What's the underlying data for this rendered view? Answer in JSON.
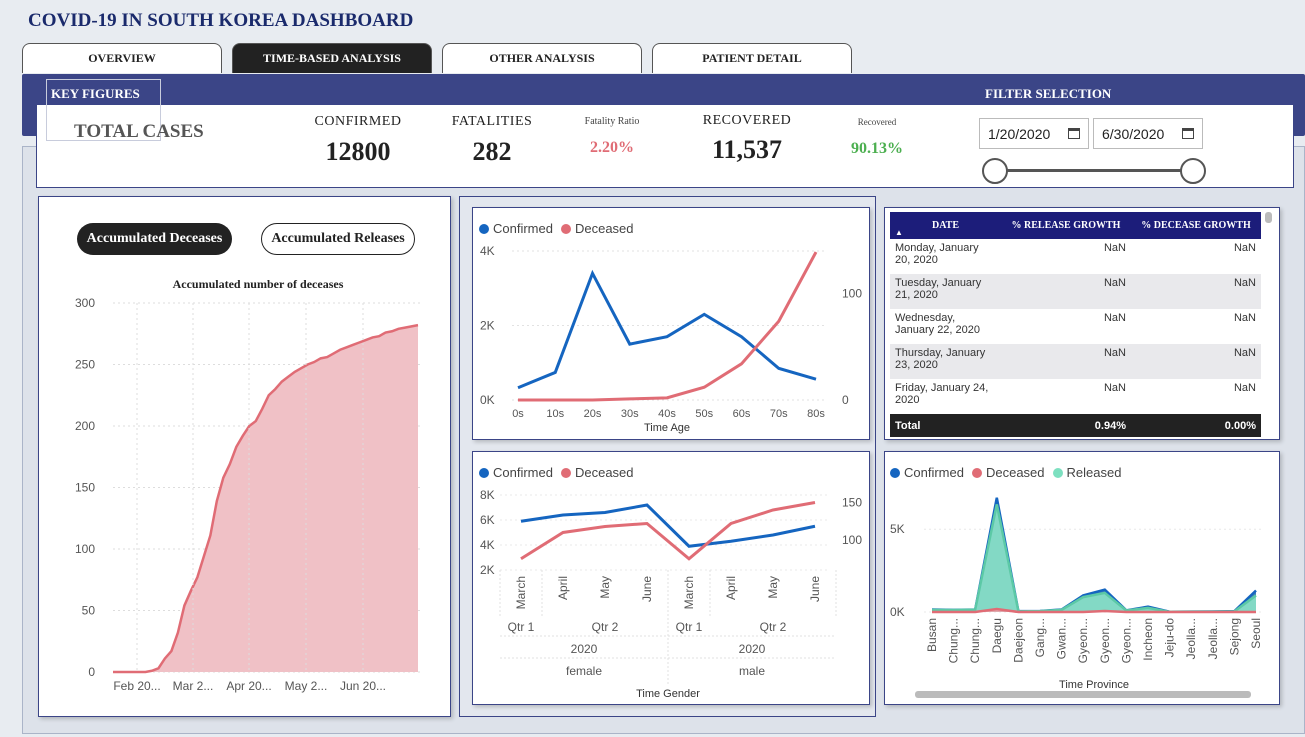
{
  "app": {
    "title": "COVID-19 IN SOUTH KOREA DASHBOARD"
  },
  "tabs": [
    {
      "label": "OVERVIEW",
      "active": false
    },
    {
      "label": "TIME-BASED ANALYSIS",
      "active": true
    },
    {
      "label": "OTHER ANALYSIS",
      "active": false
    },
    {
      "label": "PATIENT DETAIL",
      "active": false
    }
  ],
  "header": {
    "key_figures": "KEY FIGURES",
    "filter_selection": "FILTER SELECTION"
  },
  "kpis": {
    "total_cases_label": "TOTAL CASES",
    "confirmed_label": "CONFIRMED",
    "confirmed_value": "12800",
    "fatalities_label": "FATALITIES",
    "fatalities_value": "282",
    "fatality_ratio_label": "Fatality Ratio",
    "fatality_ratio_value": "2.20%",
    "recovered_label": "RECOVERED",
    "recovered_value": "11,537",
    "recovered_ratio_label": "Recovered",
    "recovered_ratio_value": "90.13%"
  },
  "filters": {
    "start_date": "1/20/2020",
    "end_date": "6/30/2020",
    "slider_range": [
      0,
      1
    ]
  },
  "colors": {
    "confirmed": "#1565c0",
    "deceased": "#e06c75",
    "released": "#7de0c0",
    "navy": "#3b4587",
    "ratio_red": "#e06c75",
    "ratio_green": "#4caf50"
  },
  "buttons": {
    "accumulated_deceases": "Accumulated Deceases",
    "accumulated_releases": "Accumulated Releases"
  },
  "chart_data": [
    {
      "type": "area",
      "title": "Accumulated number of deceases",
      "ylim": [
        0,
        300
      ],
      "yticks": [
        "0",
        "50",
        "100",
        "150",
        "200",
        "250",
        "300"
      ],
      "xticks": [
        "Feb 20...",
        "Mar 2...",
        "Apr 20...",
        "May 2...",
        "Jun 20..."
      ],
      "series": [
        {
          "values": [
            0,
            0,
            0,
            0,
            0,
            0,
            1,
            3,
            11,
            17,
            32,
            54,
            66,
            77,
            94,
            111,
            139,
            158,
            169,
            183,
            192,
            200,
            204,
            214,
            225,
            230,
            236,
            240,
            244,
            247,
            250,
            252,
            255,
            256,
            259,
            262,
            264,
            266,
            268,
            270,
            272,
            273,
            276,
            277,
            279,
            280,
            281,
            282
          ]
        }
      ]
    },
    {
      "type": "line",
      "legend": [
        "Confirmed",
        "Deceased"
      ],
      "xlabel": "Time Age",
      "categories": [
        "0s",
        "10s",
        "20s",
        "30s",
        "40s",
        "50s",
        "60s",
        "70s",
        "80s"
      ],
      "left_ticks": [
        "0K",
        "2K",
        "4K"
      ],
      "right_ticks": [
        "0",
        "100"
      ],
      "left_ylim": [
        0,
        4000
      ],
      "right_ylim": [
        0,
        140
      ],
      "series": [
        {
          "name": "Confirmed",
          "axis": "left",
          "values": [
            330,
            740,
            3400,
            1500,
            1700,
            2300,
            1700,
            850,
            560
          ]
        },
        {
          "name": "Deceased",
          "axis": "right",
          "values": [
            0,
            0,
            0,
            1,
            2,
            12,
            34,
            74,
            139
          ]
        }
      ]
    },
    {
      "type": "line",
      "legend": [
        "Confirmed",
        "Deceased"
      ],
      "xlabel": "Time Gender",
      "categories": [
        "March",
        "April",
        "May",
        "June",
        "March",
        "April",
        "May",
        "June"
      ],
      "quarters": [
        "Qtr 1",
        "Qtr 2",
        "Qtr 1",
        "Qtr 2"
      ],
      "years": [
        "2020",
        "2020"
      ],
      "genders": [
        "female",
        "male"
      ],
      "left_ticks": [
        "2K",
        "4K",
        "6K",
        "8K"
      ],
      "right_ticks": [
        "100",
        "150"
      ],
      "left_ylim": [
        2000,
        8000
      ],
      "right_ylim": [
        60,
        160
      ],
      "series": [
        {
          "name": "Confirmed",
          "axis": "left",
          "values": [
            5900,
            6400,
            6600,
            7200,
            3900,
            4300,
            4800,
            5500
          ]
        },
        {
          "name": "Deceased",
          "axis": "right",
          "values": [
            75,
            110,
            118,
            122,
            75,
            122,
            140,
            150
          ]
        }
      ]
    },
    {
      "type": "area",
      "legend": [
        "Confirmed",
        "Deceased",
        "Released"
      ],
      "xlabel": "Time Province",
      "categories": [
        "Busan",
        "Chung...",
        "Chung...",
        "Daegu",
        "Daejeon",
        "Gang...",
        "Gwan...",
        "Gyeon...",
        "Gyeon...",
        "Gyeon...",
        "Incheon",
        "Jeju-do",
        "Jeolla...",
        "Jeolla...",
        "Sejong",
        "Seoul"
      ],
      "left_ticks": [
        "0K",
        "5K"
      ],
      "ylim": [
        0,
        8000
      ],
      "series": [
        {
          "name": "Confirmed",
          "values": [
            150,
            130,
            150,
            6900,
            50,
            60,
            150,
            1000,
            1350,
            100,
            320,
            15,
            25,
            30,
            50,
            1300
          ]
        },
        {
          "name": "Deceased",
          "values": [
            3,
            0,
            0,
            180,
            0,
            3,
            0,
            2,
            60,
            0,
            0,
            0,
            0,
            0,
            0,
            2
          ]
        },
        {
          "name": "Released",
          "values": [
            130,
            120,
            140,
            6500,
            40,
            50,
            130,
            900,
            1150,
            90,
            250,
            12,
            20,
            25,
            40,
            1000
          ]
        }
      ]
    }
  ],
  "table": {
    "columns": [
      "DATE",
      "% RELEASE GROWTH",
      "% DECEASE GROWTH"
    ],
    "rows": [
      {
        "date": "Monday, January 20, 2020",
        "release": "NaN",
        "decease": "NaN"
      },
      {
        "date": "Tuesday, January 21, 2020",
        "release": "NaN",
        "decease": "NaN"
      },
      {
        "date": "Wednesday, January 22, 2020",
        "release": "NaN",
        "decease": "NaN"
      },
      {
        "date": "Thursday, January 23, 2020",
        "release": "NaN",
        "decease": "NaN"
      },
      {
        "date": "Friday, January 24, 2020",
        "release": "NaN",
        "decease": "NaN"
      }
    ],
    "total": {
      "label": "Total",
      "release": "0.94%",
      "decease": "0.00%"
    }
  }
}
